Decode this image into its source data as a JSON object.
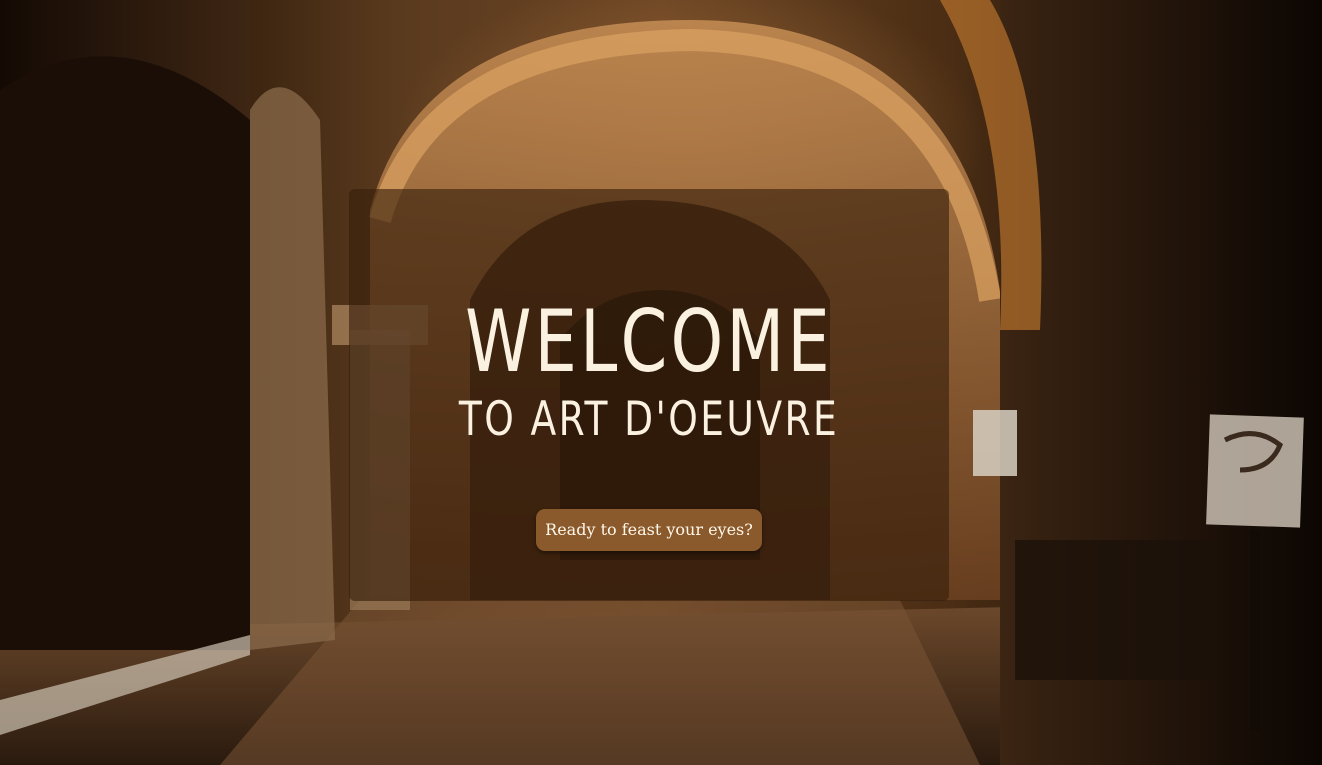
{
  "hero": {
    "title": "WELCOME",
    "subtitle": "TO ART D'OEUVRE",
    "cta_label": "Ready to feast your eyes?"
  },
  "background": {
    "icon": "cloister-arches-photo"
  },
  "colors": {
    "panel_overlay": "#371e0c",
    "button_bg": "#8a5a2c",
    "title_text": "#fbf1e1"
  }
}
